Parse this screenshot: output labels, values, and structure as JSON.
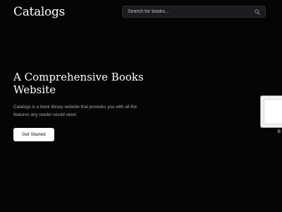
{
  "header": {
    "brand": "Catalogs",
    "search": {
      "placeholder": "Search for books..."
    }
  },
  "hero": {
    "title": "A Comprehensive Books Website",
    "description": "Catalogs is a book library website that provides you with all the features any reader would need.",
    "cta_label": "Get Started"
  },
  "featured": {
    "label": "B"
  }
}
